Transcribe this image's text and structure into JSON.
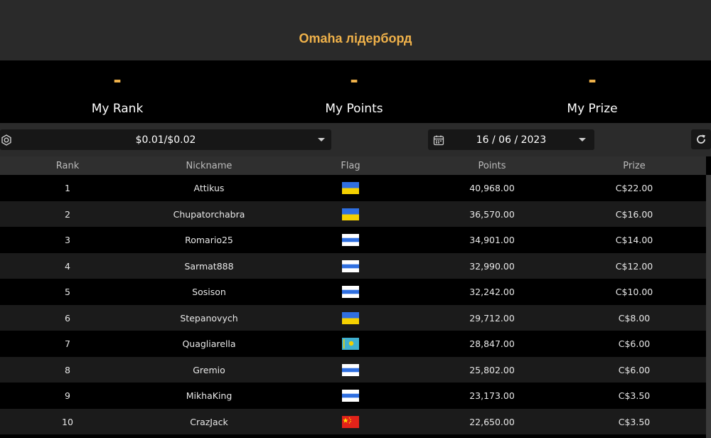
{
  "header": {
    "title": "Omaha лідерборд"
  },
  "stats": [
    {
      "value": "-",
      "label": "My Rank"
    },
    {
      "value": "-",
      "label": "My Points"
    },
    {
      "value": "-",
      "label": "My Prize"
    }
  ],
  "filters": {
    "stakes": {
      "value": "$0.01/$0.02",
      "icon": "settings-icon"
    },
    "date": {
      "value": "16 / 06 / 2023",
      "icon": "calendar-icon"
    },
    "refresh_icon": "refresh-icon"
  },
  "table": {
    "columns": [
      "Rank",
      "Nickname",
      "Flag",
      "Points",
      "Prize"
    ],
    "rows": [
      {
        "rank": "1",
        "nickname": "Attikus",
        "flag": "ukraine",
        "points": "40,968.00",
        "prize": "C$22.00"
      },
      {
        "rank": "2",
        "nickname": "Chupatorchabra",
        "flag": "ukraine",
        "points": "36,570.00",
        "prize": "C$16.00"
      },
      {
        "rank": "3",
        "nickname": "Romario25",
        "flag": "white-blue-white",
        "points": "34,901.00",
        "prize": "C$14.00"
      },
      {
        "rank": "4",
        "nickname": "Sarmat888",
        "flag": "white-blue-white",
        "points": "32,990.00",
        "prize": "C$12.00"
      },
      {
        "rank": "5",
        "nickname": "Sosison",
        "flag": "white-blue-white",
        "points": "32,242.00",
        "prize": "C$10.00"
      },
      {
        "rank": "6",
        "nickname": "Stepanovych",
        "flag": "ukraine",
        "points": "29,712.00",
        "prize": "C$8.00"
      },
      {
        "rank": "7",
        "nickname": "Quagliarella",
        "flag": "kazakhstan",
        "points": "28,847.00",
        "prize": "C$6.00"
      },
      {
        "rank": "8",
        "nickname": "Gremio",
        "flag": "white-blue-white",
        "points": "25,802.00",
        "prize": "C$6.00"
      },
      {
        "rank": "9",
        "nickname": "MikhaKing",
        "flag": "white-blue-white",
        "points": "23,173.00",
        "prize": "C$3.50"
      },
      {
        "rank": "10",
        "nickname": "CrazJack",
        "flag": "china",
        "points": "22,650.00",
        "prize": "C$3.50"
      }
    ]
  },
  "colors": {
    "accent": "#f0b24a",
    "header_bg": "#2a2a2a",
    "row_alt": "#1b1b1b"
  }
}
